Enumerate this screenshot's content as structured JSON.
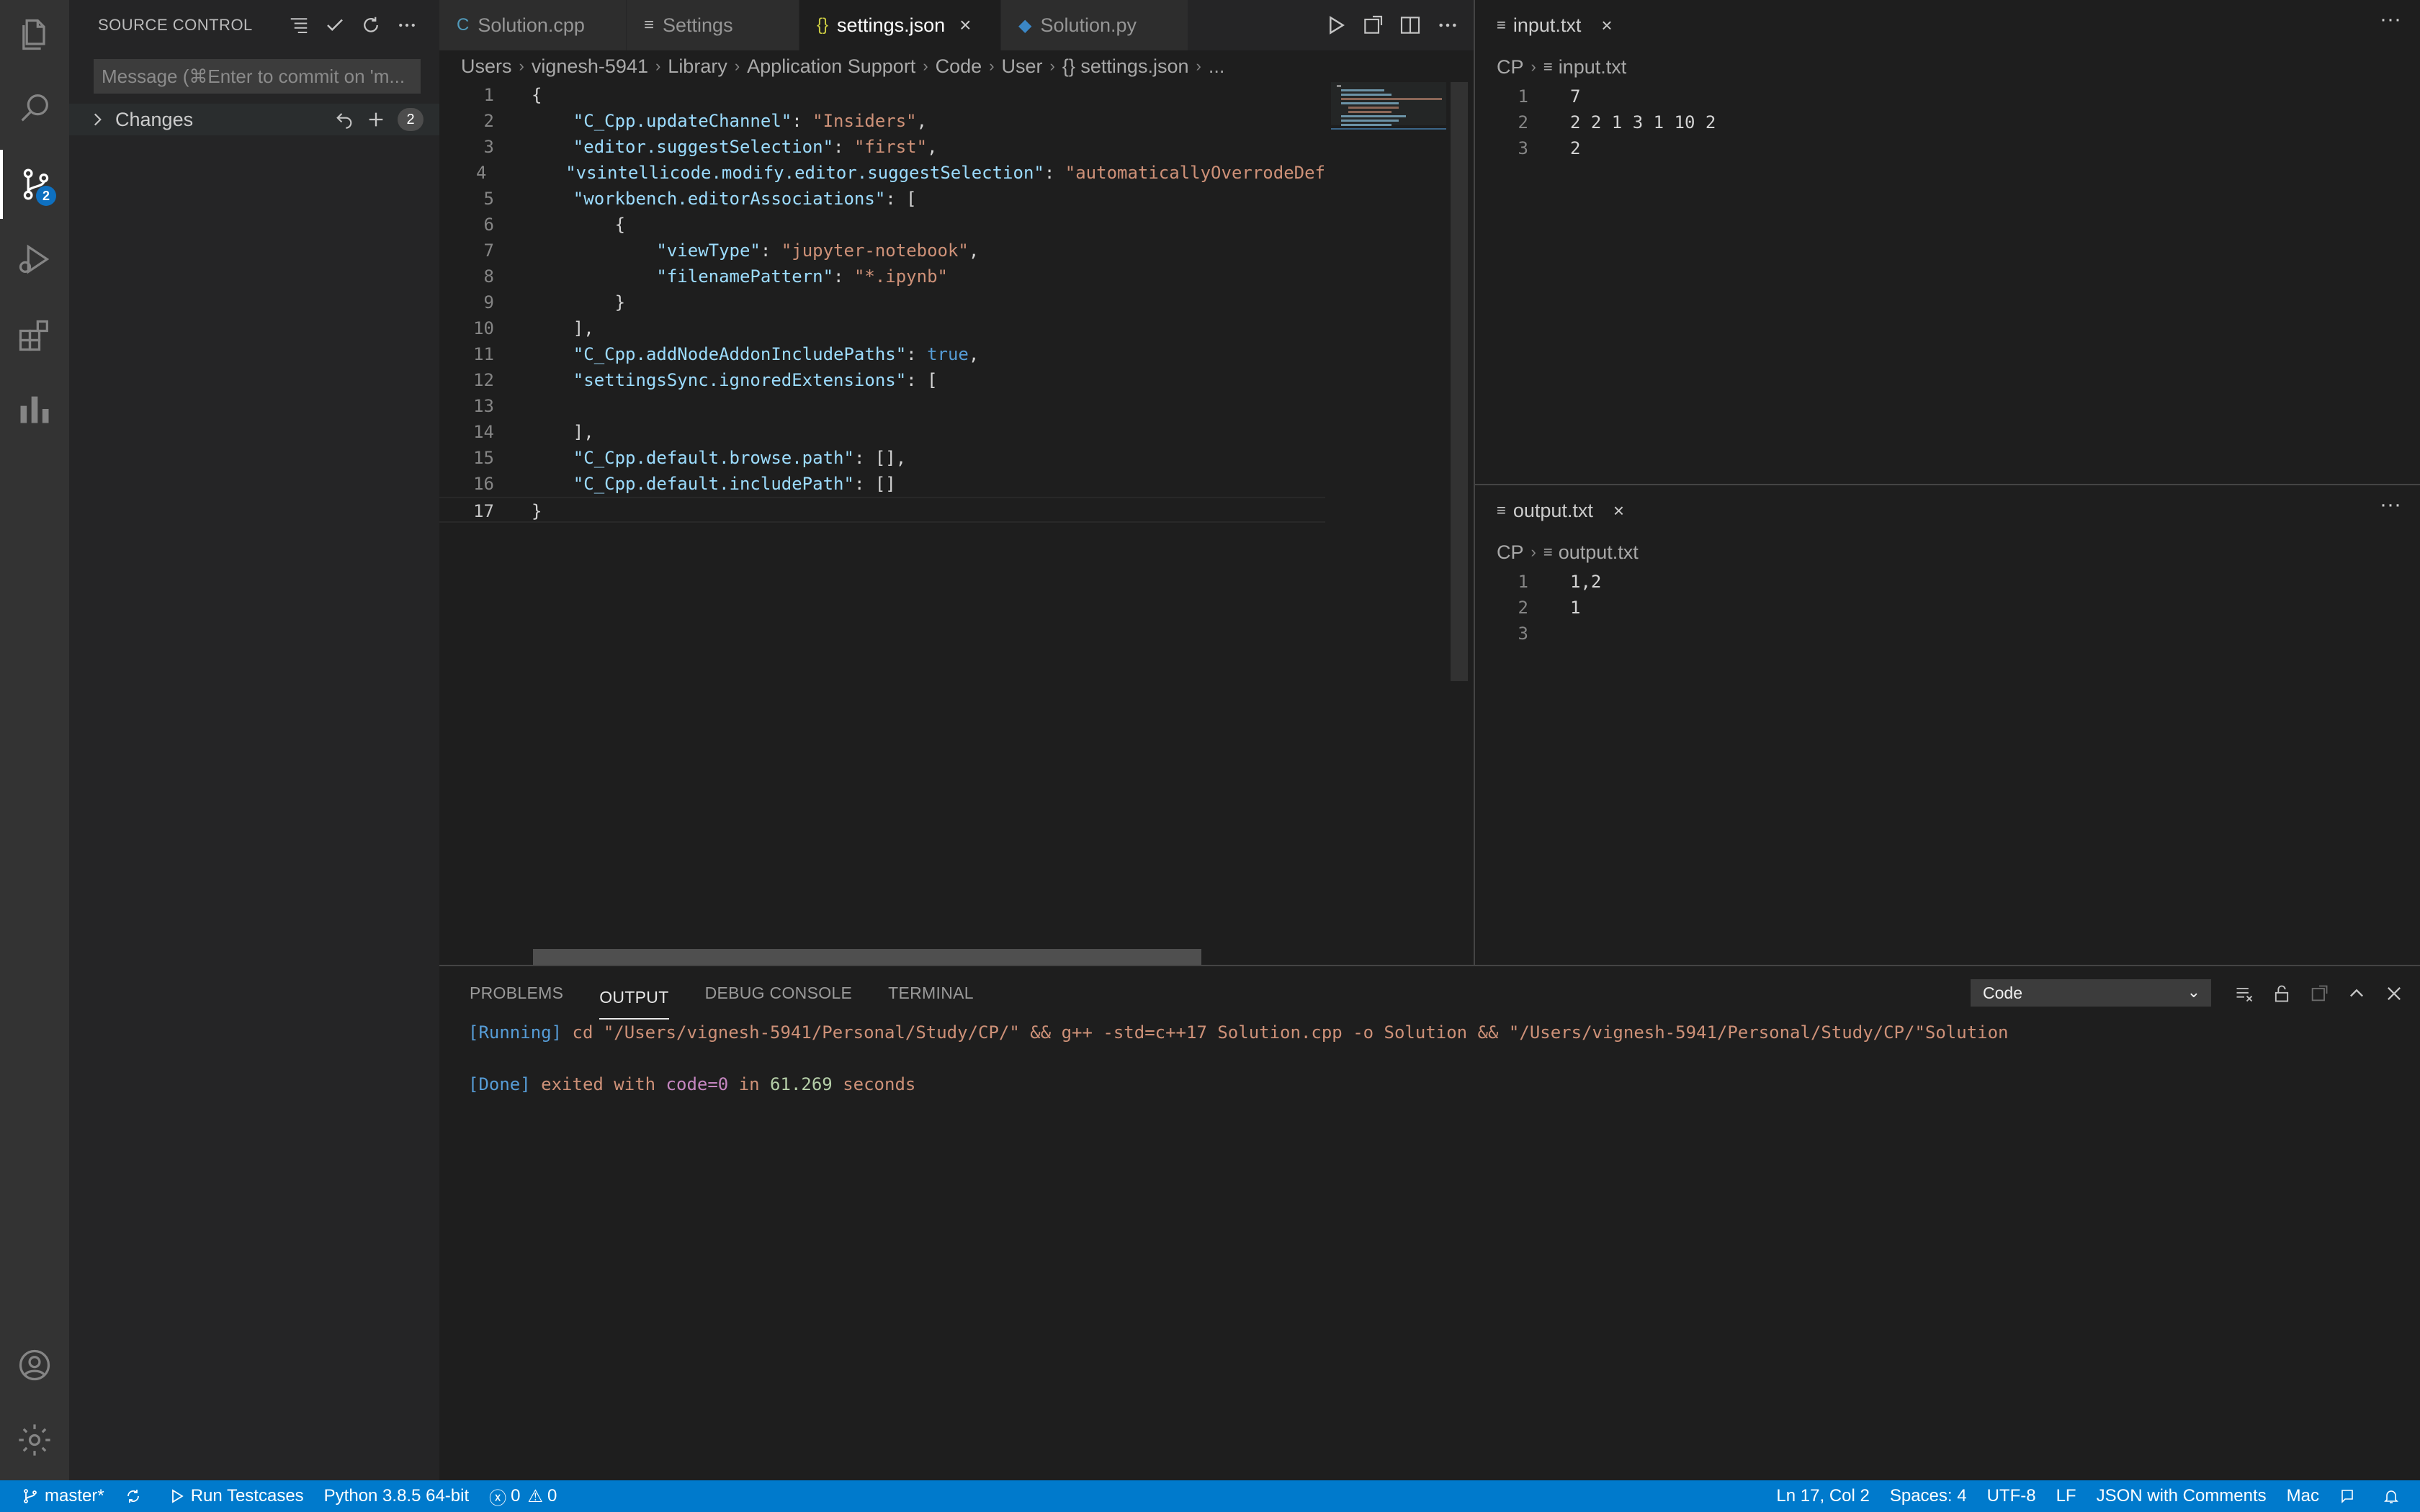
{
  "activity_bar": {
    "items": [
      "explorer-icon",
      "search-icon",
      "source-control-icon",
      "run-debug-icon",
      "extensions-icon",
      "chart-icon"
    ],
    "scm_badge": "2"
  },
  "sidebar": {
    "title": "SOURCE CONTROL",
    "commit_placeholder": "Message (⌘Enter to commit on 'm...",
    "changes_label": "Changes",
    "changes_count": "2"
  },
  "editor": {
    "tabs": [
      {
        "label": "Solution.cpp",
        "icon": "cpp-icon",
        "active": false
      },
      {
        "label": "Settings",
        "icon": "settings-icon",
        "active": false
      },
      {
        "label": "settings.json",
        "icon": "json-icon",
        "active": true
      },
      {
        "label": "Solution.py",
        "icon": "python-icon",
        "active": false
      }
    ],
    "breadcrumb": [
      "Users",
      "vignesh-5941",
      "Library",
      "Application Support",
      "Code",
      "User",
      "{} settings.json",
      "..."
    ],
    "lines": [
      {
        "n": "1",
        "t": [
          {
            "c": "p",
            "v": "{"
          }
        ]
      },
      {
        "n": "2",
        "t": [
          {
            "c": "p",
            "v": "    "
          },
          {
            "c": "k",
            "v": "\"C_Cpp.updateChannel\""
          },
          {
            "c": "p",
            "v": ": "
          },
          {
            "c": "s",
            "v": "\"Insiders\""
          },
          {
            "c": "p",
            "v": ","
          }
        ]
      },
      {
        "n": "3",
        "t": [
          {
            "c": "p",
            "v": "    "
          },
          {
            "c": "k",
            "v": "\"editor.suggestSelection\""
          },
          {
            "c": "p",
            "v": ": "
          },
          {
            "c": "s",
            "v": "\"first\""
          },
          {
            "c": "p",
            "v": ","
          }
        ]
      },
      {
        "n": "4",
        "t": [
          {
            "c": "p",
            "v": "    "
          },
          {
            "c": "k",
            "v": "\"vsintellicode.modify.editor.suggestSelection\""
          },
          {
            "c": "p",
            "v": ": "
          },
          {
            "c": "s",
            "v": "\"automaticallyOverrodeDef"
          }
        ]
      },
      {
        "n": "5",
        "t": [
          {
            "c": "p",
            "v": "    "
          },
          {
            "c": "k",
            "v": "\"workbench.editorAssociations\""
          },
          {
            "c": "p",
            "v": ": ["
          }
        ]
      },
      {
        "n": "6",
        "t": [
          {
            "c": "p",
            "v": "        {"
          }
        ]
      },
      {
        "n": "7",
        "t": [
          {
            "c": "p",
            "v": "            "
          },
          {
            "c": "k",
            "v": "\"viewType\""
          },
          {
            "c": "p",
            "v": ": "
          },
          {
            "c": "s",
            "v": "\"jupyter-notebook\""
          },
          {
            "c": "p",
            "v": ","
          }
        ]
      },
      {
        "n": "8",
        "t": [
          {
            "c": "p",
            "v": "            "
          },
          {
            "c": "k",
            "v": "\"filenamePattern\""
          },
          {
            "c": "p",
            "v": ": "
          },
          {
            "c": "s",
            "v": "\"*.ipynb\""
          }
        ]
      },
      {
        "n": "9",
        "t": [
          {
            "c": "p",
            "v": "        }"
          }
        ]
      },
      {
        "n": "10",
        "t": [
          {
            "c": "p",
            "v": "    ],"
          }
        ]
      },
      {
        "n": "11",
        "t": [
          {
            "c": "p",
            "v": "    "
          },
          {
            "c": "k",
            "v": "\"C_Cpp.addNodeAddonIncludePaths\""
          },
          {
            "c": "p",
            "v": ": "
          },
          {
            "c": "b",
            "v": "true"
          },
          {
            "c": "p",
            "v": ","
          }
        ]
      },
      {
        "n": "12",
        "t": [
          {
            "c": "p",
            "v": "    "
          },
          {
            "c": "k",
            "v": "\"settingsSync.ignoredExtensions\""
          },
          {
            "c": "p",
            "v": ": ["
          }
        ]
      },
      {
        "n": "13",
        "t": [
          {
            "c": "p",
            "v": ""
          }
        ]
      },
      {
        "n": "14",
        "t": [
          {
            "c": "p",
            "v": "    ],"
          }
        ]
      },
      {
        "n": "15",
        "t": [
          {
            "c": "p",
            "v": "    "
          },
          {
            "c": "k",
            "v": "\"C_Cpp.default.browse.path\""
          },
          {
            "c": "p",
            "v": ": [],"
          }
        ]
      },
      {
        "n": "16",
        "t": [
          {
            "c": "p",
            "v": "    "
          },
          {
            "c": "k",
            "v": "\"C_Cpp.default.includePath\""
          },
          {
            "c": "p",
            "v": ": []"
          }
        ]
      },
      {
        "n": "17",
        "t": [
          {
            "c": "p",
            "v": "}"
          }
        ]
      }
    ]
  },
  "input_panel": {
    "tab_label": "input.txt",
    "breadcrumb": [
      "CP",
      "input.txt"
    ],
    "lines": [
      {
        "n": "1",
        "v": "7"
      },
      {
        "n": "2",
        "v": "2 2 1 3 1 10 2"
      },
      {
        "n": "3",
        "v": "2"
      }
    ]
  },
  "output_file_panel": {
    "tab_label": "output.txt",
    "breadcrumb": [
      "CP",
      "output.txt"
    ],
    "lines": [
      {
        "n": "1",
        "v": "1,2"
      },
      {
        "n": "2",
        "v": "1"
      },
      {
        "n": "3",
        "v": ""
      }
    ]
  },
  "panel": {
    "tabs": [
      "PROBLEMS",
      "OUTPUT",
      "DEBUG CONSOLE",
      "TERMINAL"
    ],
    "active_tab": "OUTPUT",
    "channel": "Code",
    "running_tag": "[Running]",
    "running_cmd": " cd \"/Users/vignesh-5941/Personal/Study/CP/\" && g++ -std=c++17 Solution.cpp -o Solution && \"/Users/vignesh-5941/Personal/Study/CP/\"Solution",
    "done_tag": "[Done]",
    "done_1": " exited with ",
    "done_code": "code=0",
    "done_2": " in ",
    "done_time": "61.269",
    "done_3": " seconds"
  },
  "statusbar": {
    "branch": "master*",
    "run_testcases": "Run Testcases",
    "python": "Python 3.8.5 64-bit",
    "errors": "0",
    "warnings": "0",
    "cursor": "Ln 17, Col 2",
    "spaces": "Spaces: 4",
    "encoding": "UTF-8",
    "eol": "LF",
    "language": "JSON with Comments",
    "keymap": "Mac",
    "accent_color": "#007acc"
  }
}
